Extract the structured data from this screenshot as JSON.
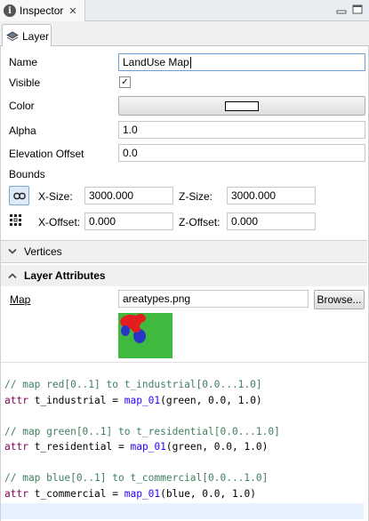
{
  "tabbar": {
    "title": "Inspector",
    "close_glyph": "✕"
  },
  "layer_tab": {
    "label": "Layer"
  },
  "properties": {
    "name_label": "Name",
    "name_value": "LandUse Map",
    "visible_label": "Visible",
    "visible_checked": true,
    "color_label": "Color",
    "color_value": "#ffffff",
    "alpha_label": "Alpha",
    "alpha_value": "1.0",
    "elevation_label": "Elevation Offset",
    "elevation_value": "0.0"
  },
  "bounds": {
    "title": "Bounds",
    "xsize_label": "X-Size:",
    "xsize_value": "3000.000",
    "zsize_label": "Z-Size:",
    "zsize_value": "3000.000",
    "xoffset_label": "X-Offset:",
    "xoffset_value": "0.000",
    "zoffset_label": "Z-Offset:",
    "zoffset_value": "0.000"
  },
  "vertices": {
    "title": "Vertices",
    "expanded": false
  },
  "layer_attributes": {
    "title": "Layer Attributes",
    "expanded": true,
    "map_label": "Map",
    "map_file": "areatypes.png",
    "browse_label": "Browse..."
  },
  "code": {
    "lines": [
      "// map red[0..1] to t_industrial[0.0...1.0]",
      "attr t_industrial = map_01(green, 0.0, 1.0)",
      "",
      "// map green[0..1] to t_residential[0.0...1.0]",
      "attr t_residential = map_01(green, 0.0, 1.0)",
      "",
      "// map blue[0..1] to t_commercial[0.0...1.0]",
      "attr t_commercial = map_01(blue, 0.0, 1.0)"
    ]
  },
  "icons": {
    "tab": "info-icon",
    "layer": "layer-icon",
    "link": "link-icon",
    "anchor": "anchor-grid-icon",
    "minimize": "minimize-icon",
    "maximize": "maximize-icon"
  }
}
